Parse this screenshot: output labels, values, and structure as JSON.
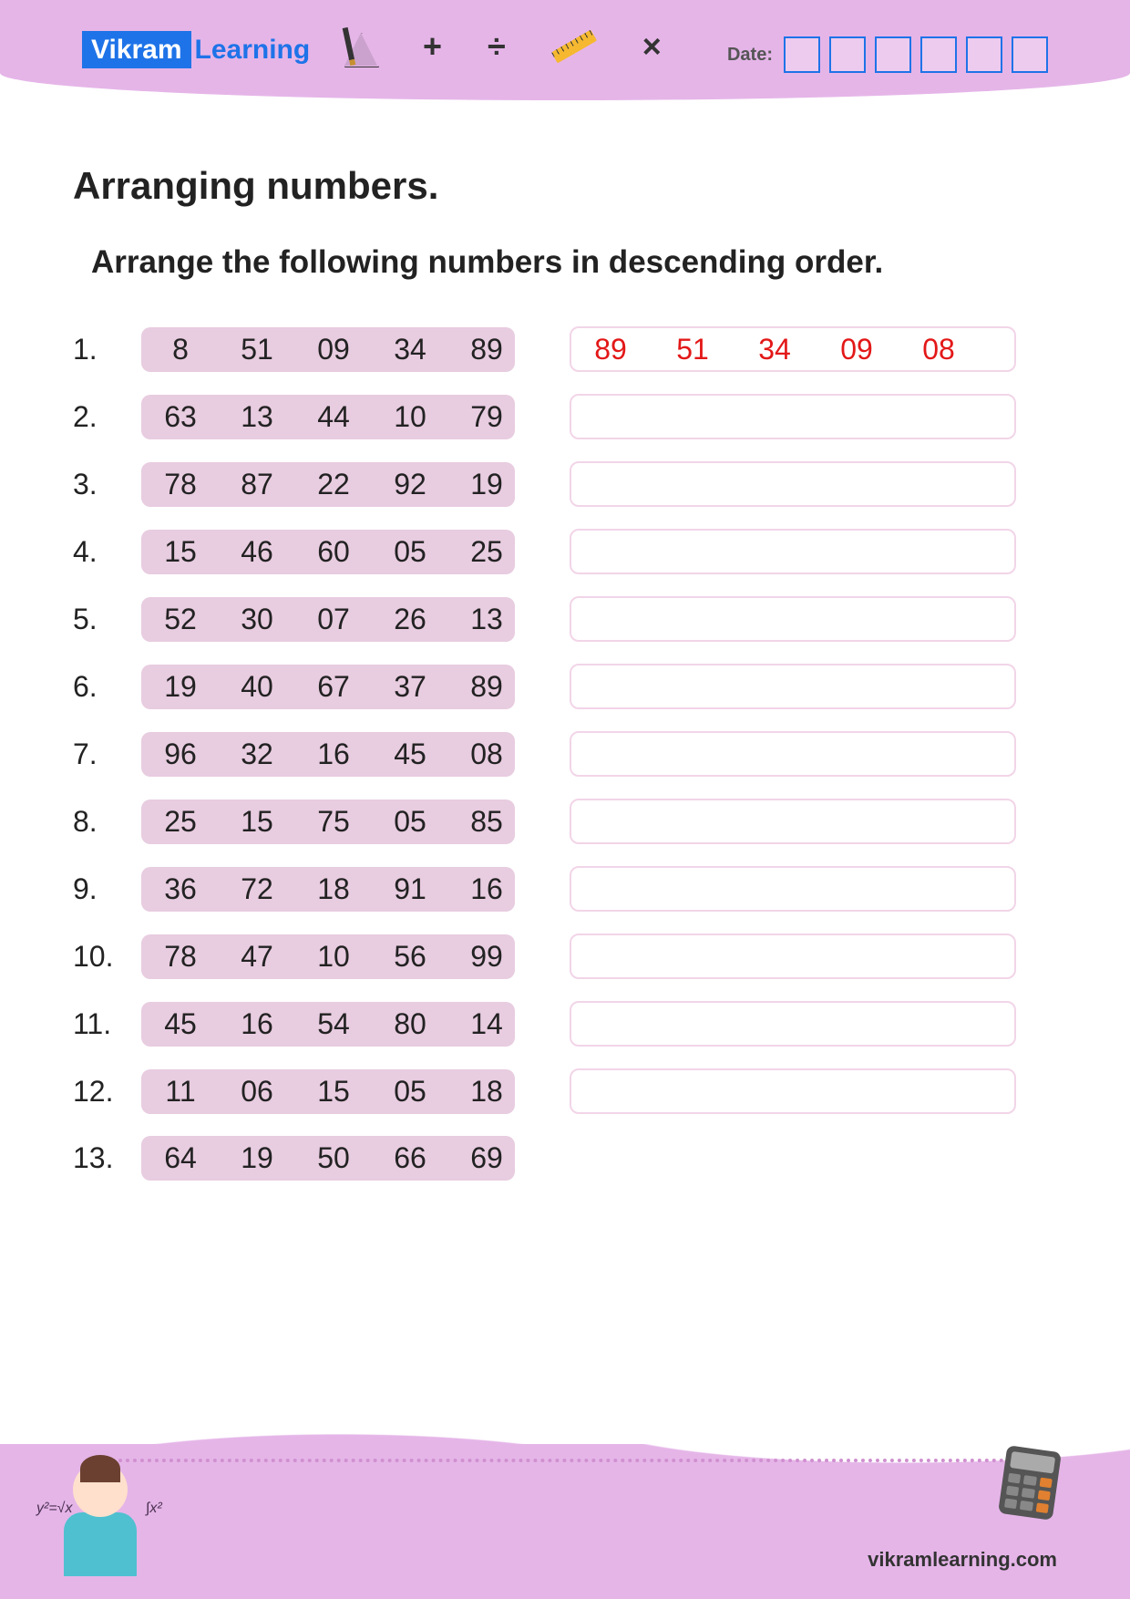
{
  "logo": {
    "part1": "Vikram",
    "part2": "Learning"
  },
  "header": {
    "symbols": {
      "plus": "+",
      "div": "÷",
      "mul": "×"
    },
    "date_label": "Date:"
  },
  "title": "Arranging numbers.",
  "instruction": "Arrange the following numbers in descending order.",
  "rows": [
    {
      "n": "1.",
      "nums": [
        "8",
        "51",
        "09",
        "34",
        "89"
      ],
      "answer": [
        "89",
        "51",
        "34",
        "09",
        "08"
      ]
    },
    {
      "n": "2.",
      "nums": [
        "63",
        "13",
        "44",
        "10",
        "79"
      ],
      "answer": null
    },
    {
      "n": "3.",
      "nums": [
        "78",
        "87",
        "22",
        "92",
        "19"
      ],
      "answer": null
    },
    {
      "n": "4.",
      "nums": [
        "15",
        "46",
        "60",
        "05",
        "25"
      ],
      "answer": null
    },
    {
      "n": "5.",
      "nums": [
        "52",
        "30",
        "07",
        "26",
        "13"
      ],
      "answer": null
    },
    {
      "n": "6.",
      "nums": [
        "19",
        "40",
        "67",
        "37",
        "89"
      ],
      "answer": null
    },
    {
      "n": "7.",
      "nums": [
        "96",
        "32",
        "16",
        "45",
        "08"
      ],
      "answer": null
    },
    {
      "n": "8.",
      "nums": [
        "25",
        "15",
        "75",
        "05",
        "85"
      ],
      "answer": null
    },
    {
      "n": "9.",
      "nums": [
        "36",
        "72",
        "18",
        "91",
        "16"
      ],
      "answer": null
    },
    {
      "n": "10.",
      "nums": [
        "78",
        "47",
        "10",
        "56",
        "99"
      ],
      "answer": null
    },
    {
      "n": "11.",
      "nums": [
        "45",
        "16",
        "54",
        "80",
        "14"
      ],
      "answer": null
    },
    {
      "n": "12.",
      "nums": [
        "11",
        "06",
        "15",
        "05",
        "18"
      ],
      "answer": null
    },
    {
      "n": "13.",
      "nums": [
        "64",
        "19",
        "50",
        "66",
        "69"
      ],
      "answer": null
    }
  ],
  "footer": {
    "site": "vikramlearning.com"
  }
}
